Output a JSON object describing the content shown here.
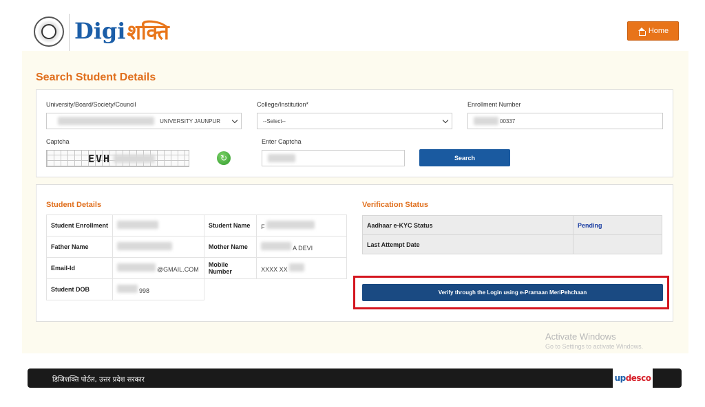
{
  "header": {
    "logo_latin": "Digi",
    "logo_hindi": "शक्ति",
    "home_label": "Home"
  },
  "search": {
    "title": "Search Student Details",
    "university_label": "University/Board/Society/Council",
    "university_value": "UNIVERSITY JAUNPUR",
    "college_label": "College/Institution*",
    "college_value": "--Select--",
    "enrollment_label": "Enrollment Number",
    "enrollment_value": "00337",
    "captcha_label": "Captcha",
    "captcha_text": "EVH",
    "enter_captcha_label": "Enter Captcha",
    "search_button": "Search"
  },
  "student_details": {
    "title": "Student Details",
    "enrollment_label": "Student Enrollment",
    "name_label": "Student Name",
    "name_value": "F",
    "father_label": "Father Name",
    "mother_label": "Mother Name",
    "mother_value": "A DEVI",
    "email_label": "Email-Id",
    "email_value": "@GMAIL.COM",
    "mobile_label": "Mobile Number",
    "mobile_value": "XXXX XX",
    "dob_label": "Student DOB",
    "dob_value": "998"
  },
  "verification": {
    "title": "Verification Status",
    "kyc_label": "Aadhaar e-KYC Status",
    "kyc_value": "Pending",
    "last_attempt_label": "Last Attempt Date",
    "last_attempt_value": "",
    "verify_button": "Verify through the Login using e-Pramaan MeriPehchaan"
  },
  "watermark": {
    "title": "Activate Windows",
    "subtitle": "Go to Settings to activate Windows."
  },
  "footer": {
    "text": "डिजिशक्ति पोर्टल, उत्तर प्रदेश सरकार",
    "partner_logo_a": "up",
    "partner_logo_b": "desco"
  },
  "colors": {
    "accent_orange": "#e06f1d",
    "primary_blue": "#1a5aa0",
    "highlight_red": "#d4161f"
  }
}
